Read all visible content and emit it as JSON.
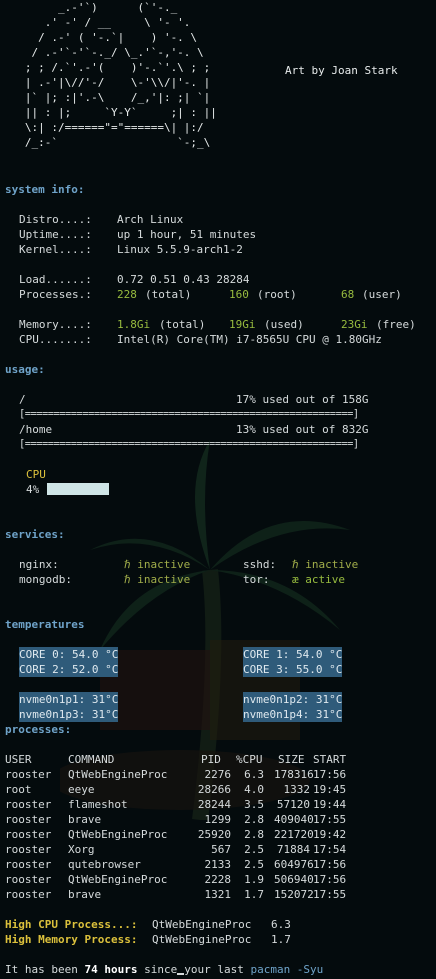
{
  "art_lines": [
    "        _.-'`)      (`'-._",
    "      .' -' / __     \\ '- '.",
    "     / .-' ( '-.`|    ) '-. \\",
    "    / .-'`-'`-._/ \\_.'`-,'-. \\",
    "   ; ; /.`'.-'(    )'-.`'.\\ ; ;",
    "   | .-'|\\//'-/    \\-'\\\\/|'-. |",
    "   |` |; :|'.-\\    /_,'|: ;| `|",
    "   || : |;     `Y-Y`     ;| : ||",
    "   \\:| :/======\"=\"======\\| |:/",
    "   /_:-`                  `-;_\\"
  ],
  "art_credit": "Art by Joan Stark",
  "system": {
    "header": "system info:",
    "distro_label": "Distro....:",
    "distro": "Arch Linux",
    "uptime_label": "Uptime....:",
    "uptime": "up 1 hour, 51 minutes",
    "kernel_label": "Kernel....:",
    "kernel": "Linux 5.5.9-arch1-2",
    "load_label": "Load......:",
    "load": "0.72 0.51 0.43 28284",
    "processes_label": "Processes.:",
    "proc_total": "228",
    "proc_total_txt": "(total)",
    "proc_root": "160",
    "proc_root_txt": "(root)",
    "proc_user": "68",
    "proc_user_txt": "(user)",
    "memory_label": "Memory....:",
    "mem_total": "1.8Gi",
    "mem_total_txt": "(total)",
    "mem_used": "19Gi",
    "mem_used_txt": "(used)",
    "mem_free": "23Gi",
    "mem_free_txt": "(free)",
    "cpu_label": "CPU.......:",
    "cpu": "Intel(R) Core(TM) i7-8565U CPU @ 1.80GHz"
  },
  "usage": {
    "header": "usage:",
    "disks": [
      {
        "mount": "/",
        "summary": "17% used out of 158G",
        "bar": "[=========================================================]"
      },
      {
        "mount": "/home",
        "summary": "13% used out of 832G",
        "bar": "[=========================================================]"
      }
    ],
    "cpu_label": "CPU",
    "cpu_percent": "4%"
  },
  "services": {
    "header": "services:",
    "items": [
      {
        "name": "nginx:",
        "state": "ℏ inactive"
      },
      {
        "name": "sshd:",
        "state": "ℏ inactive"
      },
      {
        "name": "mongodb:",
        "state": "ℏ inactive"
      },
      {
        "name": "tor:",
        "state": "æ active"
      }
    ]
  },
  "temperatures": {
    "header": "temperatures",
    "cores": [
      "CORE 0: 54.0 °C",
      "CORE 1: 54.0 °C",
      "CORE 2: 52.0 °C",
      "CORE 3: 55.0 °C"
    ],
    "nvme": [
      "nvme0n1p1: 31°C",
      "nvme0n1p2: 31°C",
      "nvme0n1p3: 31°C",
      "nvme0n1p4: 31°C"
    ]
  },
  "processes": {
    "header": "processes:",
    "columns": [
      "USER",
      "COMMAND",
      "PID",
      "%CPU",
      "SIZE",
      "START"
    ],
    "rows": [
      [
        "rooster",
        "QtWebEngineProc",
        "2276",
        "6.3",
        "178316",
        "17:56"
      ],
      [
        "root",
        "eeye",
        "28266",
        "4.0",
        "1332",
        "19:45"
      ],
      [
        "rooster",
        "flameshot",
        "28244",
        "3.5",
        "57120",
        "19:44"
      ],
      [
        "rooster",
        "brave",
        "1299",
        "2.8",
        "409040",
        "17:55"
      ],
      [
        "rooster",
        "QtWebEngineProc",
        "25920",
        "2.8",
        "221720",
        "19:42"
      ],
      [
        "rooster",
        "Xorg",
        "567",
        "2.5",
        "71884",
        "17:54"
      ],
      [
        "rooster",
        "qutebrowser",
        "2133",
        "2.5",
        "604976",
        "17:56"
      ],
      [
        "rooster",
        "QtWebEngineProc",
        "2228",
        "1.9",
        "506940",
        "17:56"
      ],
      [
        "rooster",
        "brave",
        "1321",
        "1.7",
        "152072",
        "17:55"
      ]
    ],
    "high_cpu_label": "High CPU Process...:",
    "high_cpu_name": "QtWebEngineProc",
    "high_cpu_val": "6.3",
    "high_mem_label": "High Memory Process:",
    "high_mem_name": "QtWebEngineProc",
    "high_mem_val": "1.7"
  },
  "footer": {
    "prefix": "It has been ",
    "hours": "74 hours",
    "middle": " since",
    "middle2": "your last ",
    "command": "pacman -Syu"
  },
  "colors": {
    "background": "#040b0d",
    "header": "#6fa3c9",
    "green": "#97bb3f",
    "highlight": "#2f5b7a",
    "yellow": "#dcc13c"
  }
}
